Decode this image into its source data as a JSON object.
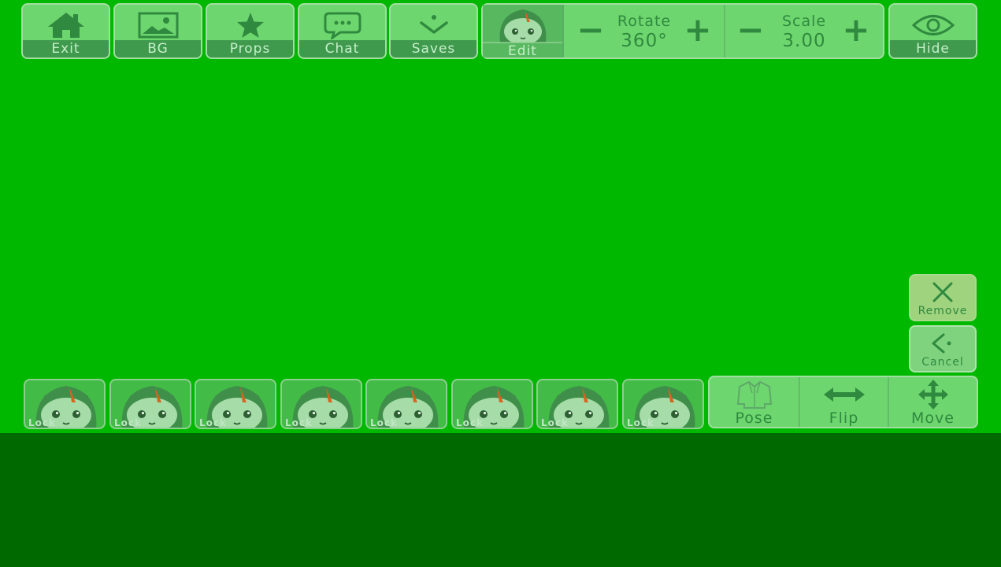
{
  "colors": {
    "stage_background": "#00b800",
    "lower_background": "#006a00",
    "icon_color": "#2f8a3f",
    "label_bar": "#3f9a4e",
    "remove_accent": "#9fd37e"
  },
  "toolbar": {
    "buttons": [
      {
        "label": "Exit",
        "icon": "house-icon"
      },
      {
        "label": "BG",
        "icon": "image-icon"
      },
      {
        "label": "Props",
        "icon": "star-icon"
      },
      {
        "label": "Chat",
        "icon": "speech-bubble-icon"
      },
      {
        "label": "Saves",
        "icon": "save-check-icon"
      }
    ],
    "edit": {
      "label": "Edit",
      "icon": "character-face-icon"
    },
    "rotate": {
      "title": "Rotate",
      "value": "360°",
      "minus": "−",
      "plus": "+"
    },
    "scale": {
      "title": "Scale",
      "value": "3.00",
      "minus": "−",
      "plus": "+"
    },
    "hide": {
      "label": "Hide",
      "icon": "eye-icon"
    }
  },
  "side_actions": {
    "remove": {
      "label": "Remove",
      "icon": "x-icon"
    },
    "cancel": {
      "label": "Cancel",
      "icon": "back-arrow-icon"
    }
  },
  "character_slots": {
    "lock_label": "Lock",
    "slots": [
      "slot-1",
      "slot-2",
      "slot-3",
      "slot-4",
      "slot-5",
      "slot-6",
      "slot-7",
      "slot-8"
    ]
  },
  "actions": {
    "pose": {
      "label": "Pose",
      "icon": "jacket-icon"
    },
    "flip": {
      "label": "Flip",
      "icon": "double-arrow-icon"
    },
    "move": {
      "label": "Move",
      "icon": "four-way-arrow-icon"
    }
  }
}
